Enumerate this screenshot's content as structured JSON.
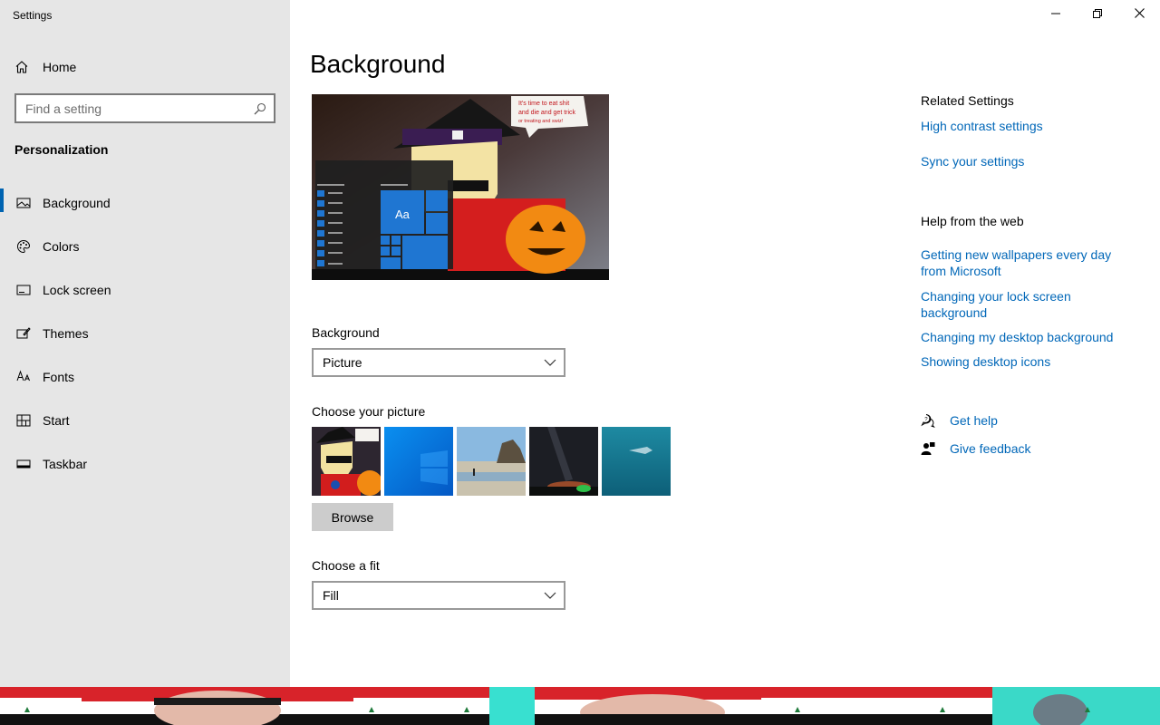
{
  "window": {
    "title": "Settings",
    "controls": [
      "minimize-icon",
      "restore-icon",
      "close-icon"
    ]
  },
  "sidebar": {
    "home_label": "Home",
    "search_placeholder": "Find a setting",
    "section_title": "Personalization",
    "items": [
      {
        "label": "Background",
        "icon": "background-icon",
        "active": true
      },
      {
        "label": "Colors",
        "icon": "palette-icon",
        "active": false
      },
      {
        "label": "Lock screen",
        "icon": "lock-screen-icon",
        "active": false
      },
      {
        "label": "Themes",
        "icon": "themes-icon",
        "active": false
      },
      {
        "label": "Fonts",
        "icon": "fonts-icon",
        "active": false
      },
      {
        "label": "Start",
        "icon": "start-icon",
        "active": false
      },
      {
        "label": "Taskbar",
        "icon": "taskbar-icon",
        "active": false
      }
    ]
  },
  "main": {
    "title": "Background",
    "preview": {
      "speech_text": "It's time to eat shit and die and get trick or treating and swiz!",
      "tile_label": "Aa"
    },
    "background_label": "Background",
    "background_value": "Picture",
    "choose_picture_label": "Choose your picture",
    "browse_label": "Browse",
    "choose_fit_label": "Choose a fit",
    "fit_value": "Fill"
  },
  "related": {
    "title": "Related Settings",
    "links": [
      "High contrast settings",
      "Sync your settings"
    ]
  },
  "help_web": {
    "title": "Help from the web",
    "links": [
      "Getting new wallpapers every day from Microsoft",
      "Changing your lock screen background",
      "Changing my desktop background",
      "Showing desktop icons"
    ]
  },
  "support": {
    "get_help": "Get help",
    "give_feedback": "Give feedback"
  },
  "colors": {
    "accent": "#0063b1",
    "link": "#0067b8",
    "sidebar_bg": "#e6e6e6"
  }
}
